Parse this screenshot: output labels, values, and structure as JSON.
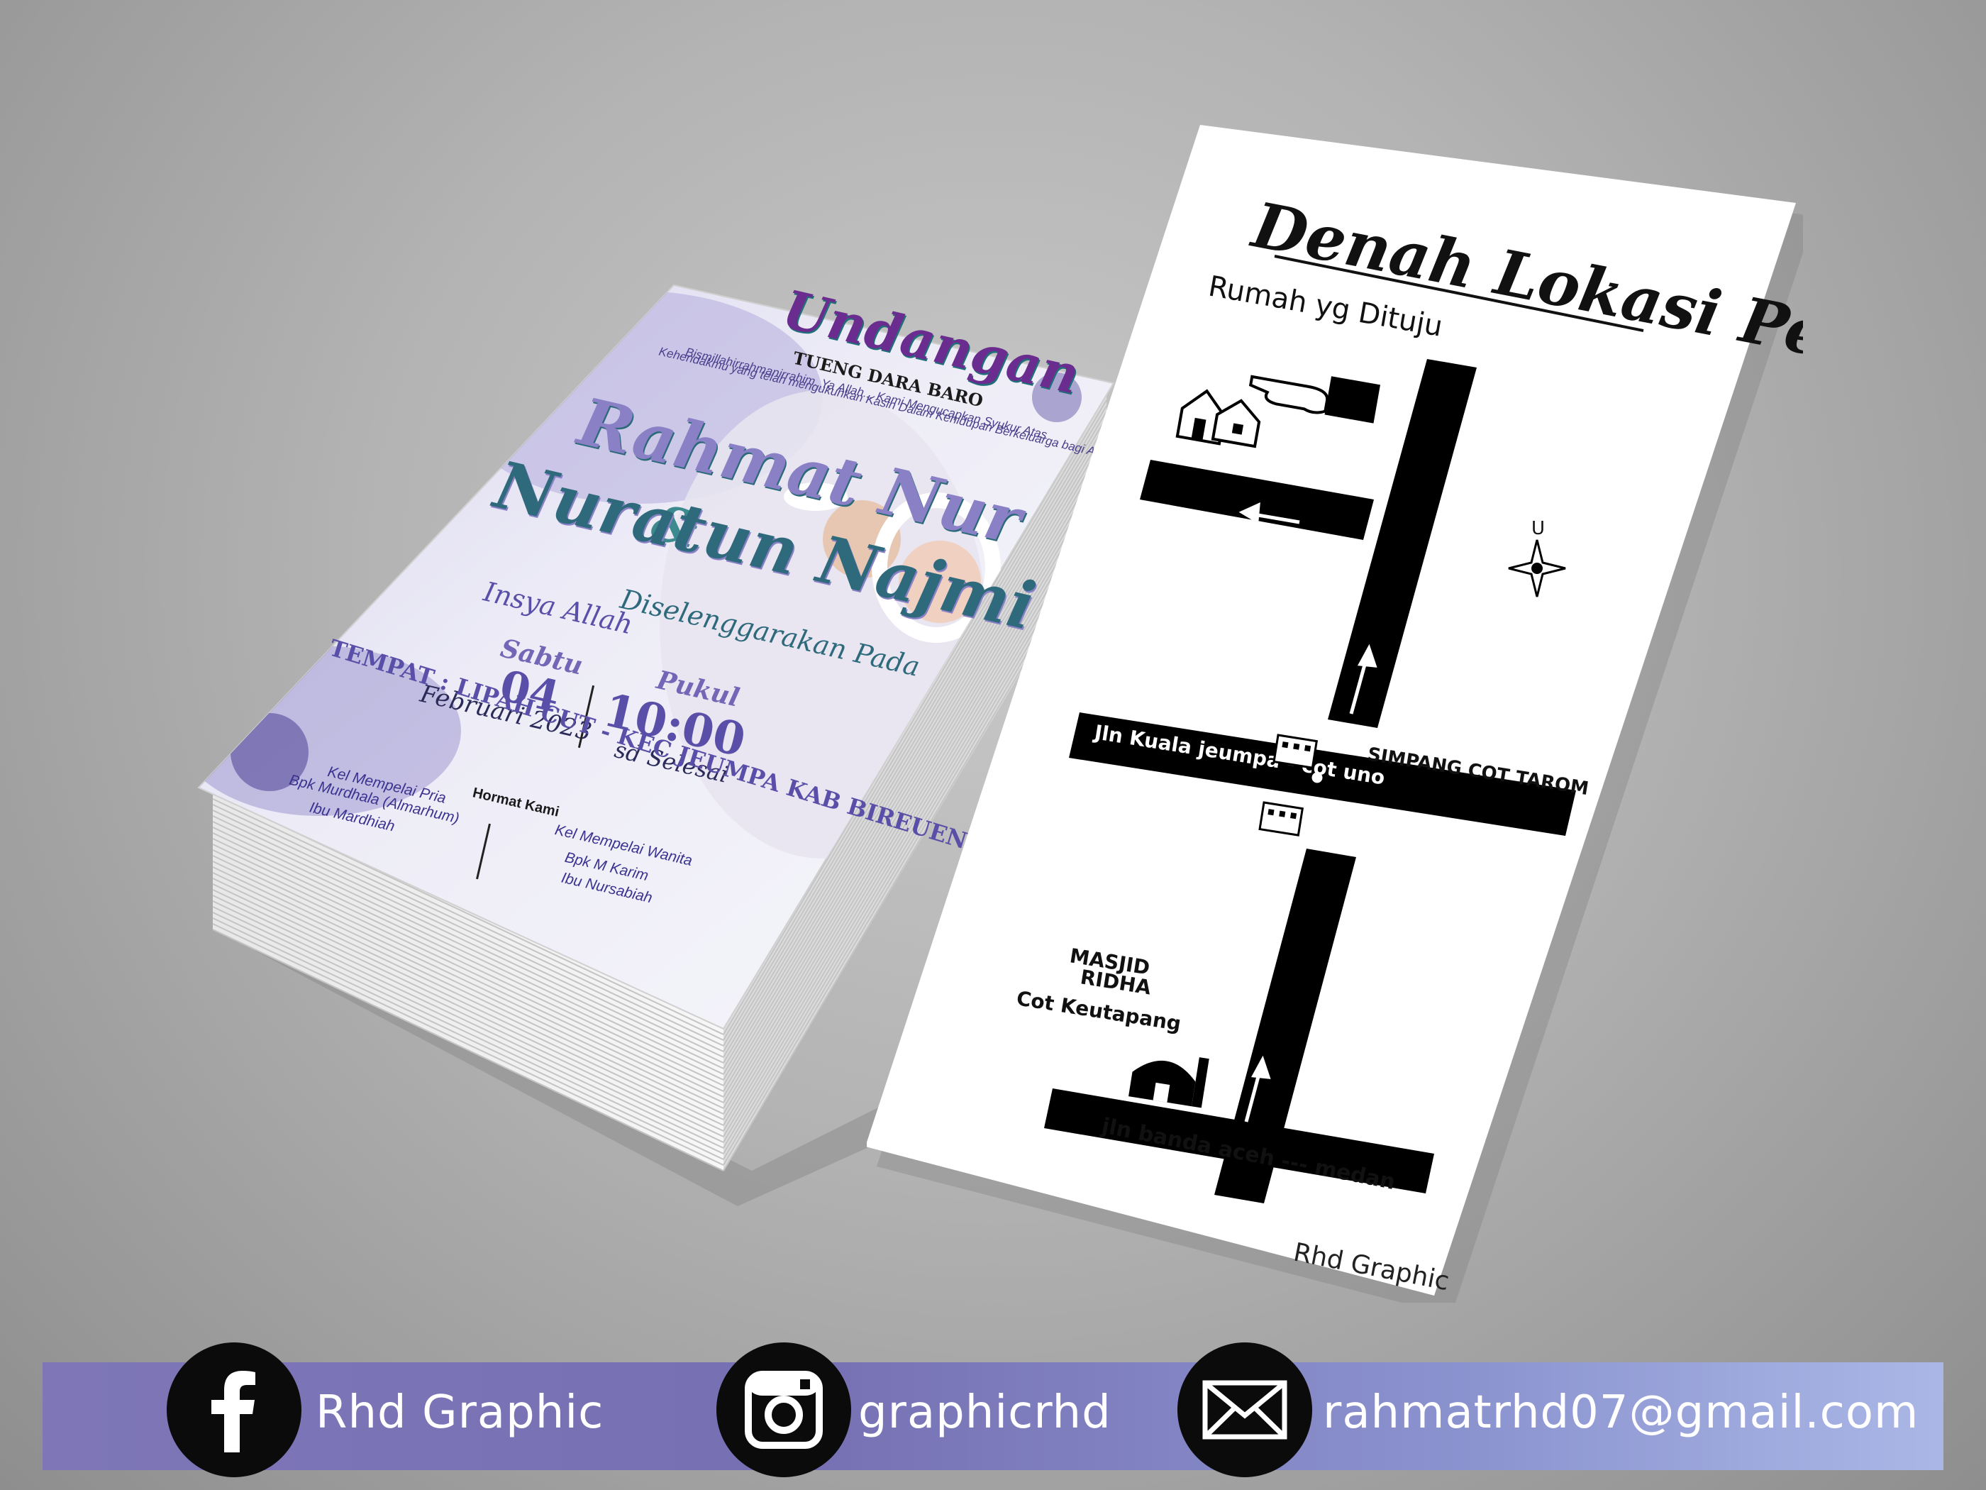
{
  "invitation_card": {
    "title": "Undangan",
    "subtitle": "TUENG DARA BARO",
    "greeting_line1": "Bismillahirrahmanirrahim. Ya Allah... Kami Mengucapkan Syukur Atas",
    "greeting_line2": "Kehendakmu yang telah mengukuhkan Kasih Dalam Kehidupan Berkeluarga bagi Anak kami :",
    "groom": "Rahmat Nur",
    "ampersand": "&",
    "bride": "Nuratun Najmi",
    "insya": "Insya Allah",
    "held_on": "Diselenggarakan Pada",
    "day_name": "Sabtu",
    "day_number": "04",
    "month_year": "Februari 2023",
    "time_label": "Pukul",
    "time": "10:00",
    "time_until": "sd Selesai",
    "place": "TEMPAT : LIPAH CUT - KEC JEUMPA KAB BIREUEN",
    "regards": "Hormat Kami",
    "groom_family_title": "Kel Mempelai Pria",
    "groom_father": "Bpk Murdhala (Almarhum)",
    "groom_mother": "Ibu Mardhiah",
    "bride_family_title": "Kel Mempelai Wanita",
    "bride_father": "Bpk M Karim",
    "bride_mother": "Ibu Nursabiah"
  },
  "map_card": {
    "title": "Denah Lokasi Pesta",
    "destination": "Rumah yg Dituju",
    "compass_north": "U",
    "road_kuala": "Jln Kuala jeumpa - cot uno",
    "junction": "SIMPANG COT TAROM",
    "mosque_line1": "MASJID",
    "mosque_line2": "RIDHA",
    "mosque_line3": "Cot Keutapang",
    "road_banda": "jln banda aceh --- medan",
    "signature": "Rhd Graphic",
    "icons": [
      "house-icon",
      "pointing-hand-icon",
      "compass-icon",
      "building-icon",
      "mosque-icon",
      "arrow-icon"
    ]
  },
  "banner": {
    "facebook_label": "Rhd Graphic",
    "instagram_label": "graphicrhd",
    "email_label": "rahmatrhd07@gmail.com",
    "icons": [
      "facebook-icon",
      "instagram-icon",
      "mail-icon"
    ],
    "colors": {
      "banner_start": "#7e76b7",
      "banner_end": "#aab7e6",
      "circle": "#0b0b0b"
    }
  }
}
